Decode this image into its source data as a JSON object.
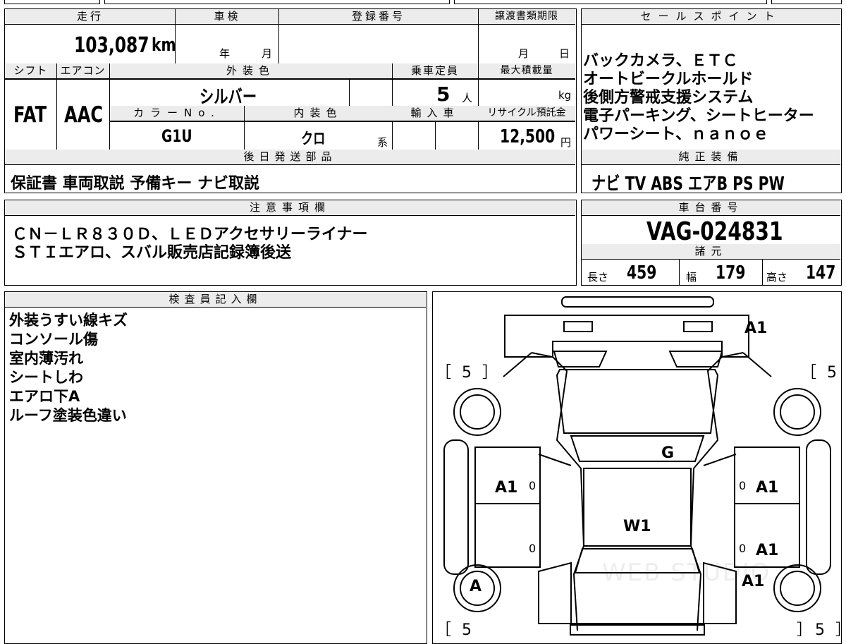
{
  "top_left": {
    "mileage": {
      "label": "走行",
      "value": "103,087",
      "unit": "km"
    },
    "inspection": {
      "label": "車検",
      "year_unit": "年",
      "month_unit": "月"
    },
    "registration": {
      "label": "登録番号",
      "value": ""
    },
    "transfer_deadline": {
      "label": "譲渡書類期限",
      "month_unit": "月",
      "day_unit": "日"
    },
    "shift": {
      "label": "シフト",
      "value": "FAT"
    },
    "aircon": {
      "label": "エアコン",
      "value": "AAC"
    },
    "exterior_color": {
      "label": "外装色",
      "value": "シルバー"
    },
    "capacity": {
      "label": "乗車定員",
      "value": "5",
      "unit": "人"
    },
    "max_load": {
      "label": "最大積載量",
      "unit": "kg"
    },
    "color_no": {
      "label": "カラーNo.",
      "value": "G1U"
    },
    "interior_color": {
      "label": "内装色",
      "value": "クロ",
      "suffix": "系"
    },
    "import": {
      "label": "輸入車"
    },
    "recycle": {
      "label": "リサイクル預託金",
      "value": "12,500",
      "unit": "円"
    },
    "later_shipping": {
      "label": "後日発送部品",
      "value": "保証書 車両取説 予備キー ナビ取説"
    }
  },
  "sales_points": {
    "label": "セールスポイント",
    "lines": [
      "バックカメラ、ＥＴＣ",
      "オートビークルホールド",
      "後側方警戒支援システム",
      "電子パーキング、シートヒーター",
      "パワーシート、ｎａｎｏｅ"
    ]
  },
  "genuine_equipment": {
    "label": "純正装備",
    "value": "ナビ TV ABS エアB PS PW"
  },
  "notes": {
    "label": "注意事項欄",
    "lines": [
      "ＣＮ－ＬＲ８３０Ｄ、ＬＥＤアクセサリーライナー",
      "ＳＴＩエアロ、スバル販売店記録簿後送"
    ]
  },
  "chassis": {
    "label": "車台番号",
    "value": "VAG-024831"
  },
  "specs": {
    "label": "諸元",
    "length_label": "長さ",
    "length": "459",
    "width_label": "幅",
    "width": "179",
    "height_label": "高さ",
    "height": "147"
  },
  "inspector": {
    "label": "検査員記入欄",
    "lines": [
      "外装うすい線キズ",
      "コンソール傷",
      "室内薄汚れ",
      "シートしわ",
      "エアロ下A",
      "ルーフ塗装色違い"
    ]
  },
  "diagram": {
    "tire_left_top": "［ 5 ］",
    "tire_right_top": "［ 5 ］",
    "tire_left_bottom": "［ 5",
    "tire_right_bottom": "］5 ］",
    "mark_front_bumper": "A1",
    "mark_hood": "G",
    "mark_left_front_door": "A1",
    "mark_right_front_door": "A1",
    "mark_roof": "W1",
    "mark_right_rear_door": "A1",
    "mark_right_rear": "A1",
    "mark_left_rear_wheel": "A",
    "zero_left_front": "0",
    "zero_left_rear": "0",
    "zero_right_front": "0",
    "zero_right_rear": "0",
    "watermark": "WEB STUDIO"
  }
}
